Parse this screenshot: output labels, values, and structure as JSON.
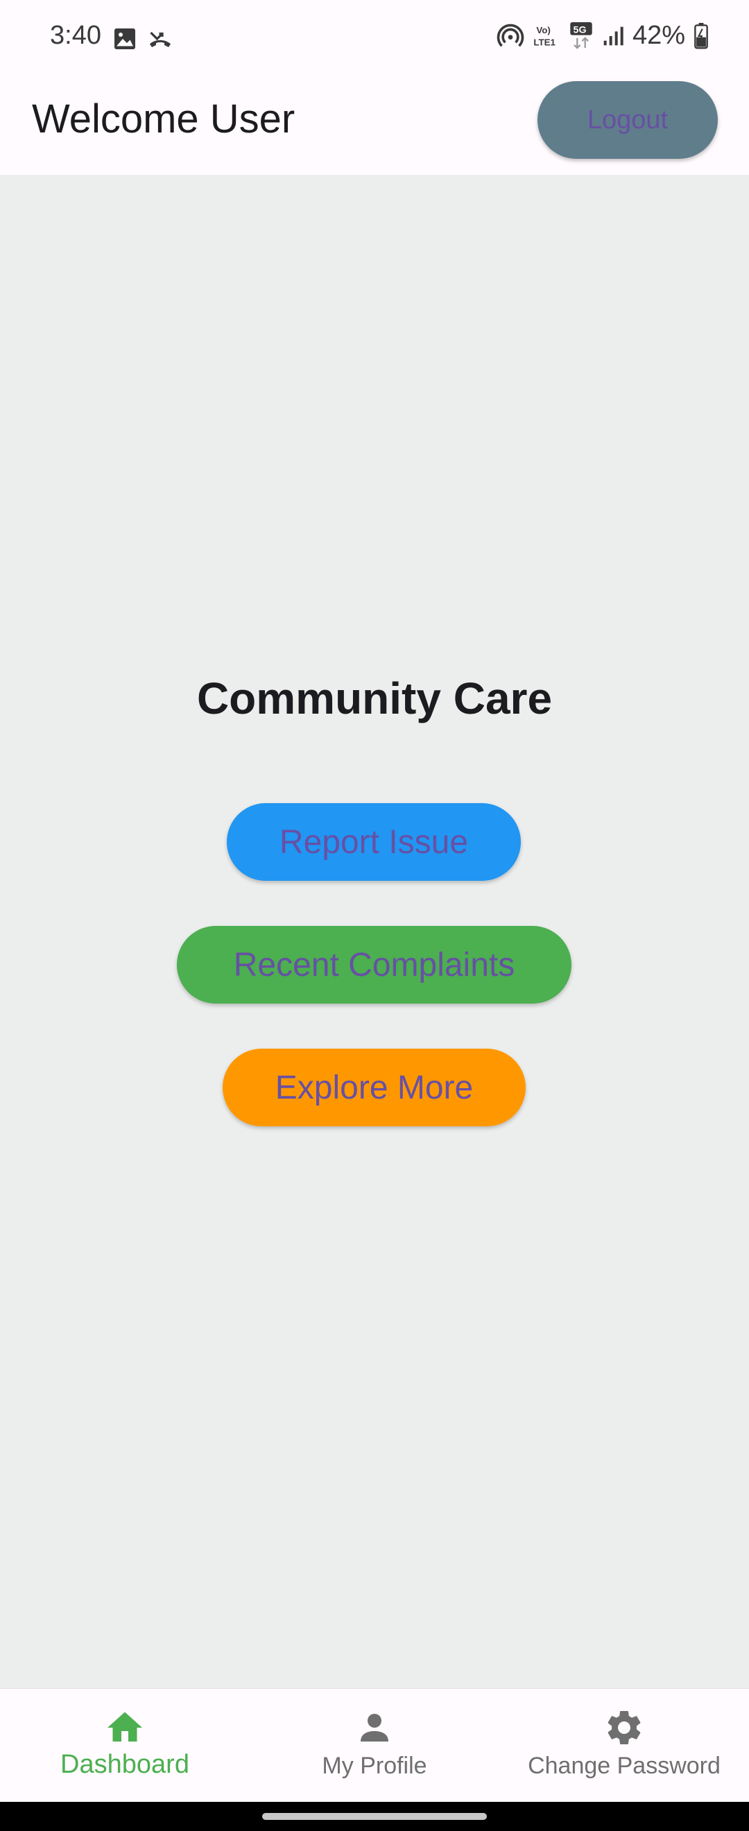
{
  "status_bar": {
    "time": "3:40",
    "battery": "42%",
    "left_icons": [
      "gallery-icon",
      "missed-call-icon"
    ],
    "right_icons": [
      "hotspot-icon",
      "volte-icon",
      "5g-icon",
      "signal-icon",
      "battery-icon"
    ]
  },
  "app_bar": {
    "title": "Welcome User",
    "logout_label": "Logout"
  },
  "main": {
    "heading": "Community Care",
    "buttons": [
      {
        "label": "Report Issue",
        "color": "#2196f3"
      },
      {
        "label": "Recent Complaints",
        "color": "#4caf50"
      },
      {
        "label": "Explore More",
        "color": "#ff9800"
      }
    ]
  },
  "bottom_nav": {
    "items": [
      {
        "label": "Dashboard",
        "icon": "home-icon",
        "active": true
      },
      {
        "label": "My Profile",
        "icon": "person-icon",
        "active": false
      },
      {
        "label": "Change Password",
        "icon": "gear-icon",
        "active": false
      }
    ]
  },
  "colors": {
    "accent_active": "#4caf50",
    "button_text": "#6750a4",
    "logout_bg": "#607d8b",
    "body_bg": "#eceeed"
  }
}
